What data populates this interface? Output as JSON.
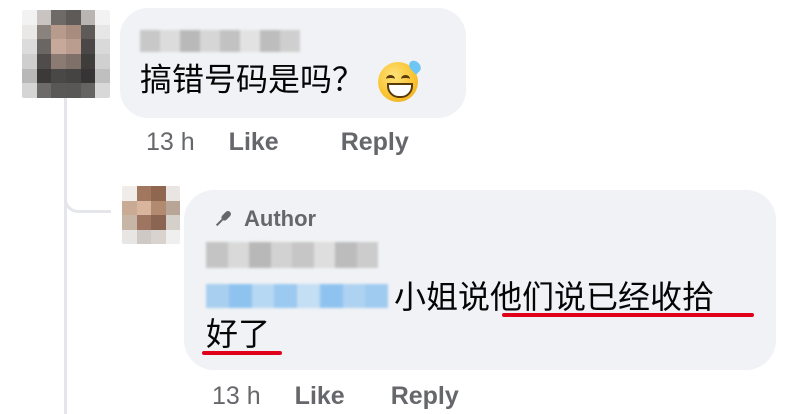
{
  "comment": {
    "text": "搞错号码是吗？",
    "emoji": "grinning-face-with-sweat",
    "actions": {
      "time": "13 h",
      "like": "Like",
      "reply": "Reply"
    }
  },
  "reply": {
    "badge": "Author",
    "text_line1": "小姐说他们说已经收拾",
    "text_line2": "好了",
    "actions": {
      "time": "13 h",
      "like": "Like",
      "reply": "Reply"
    }
  },
  "colors": {
    "bubble": "#f0f2f5",
    "meta_text": "#65676b",
    "body_text": "#050505",
    "highlight_underline": "#e0001a",
    "mention_blur": "#8fc3ef"
  }
}
